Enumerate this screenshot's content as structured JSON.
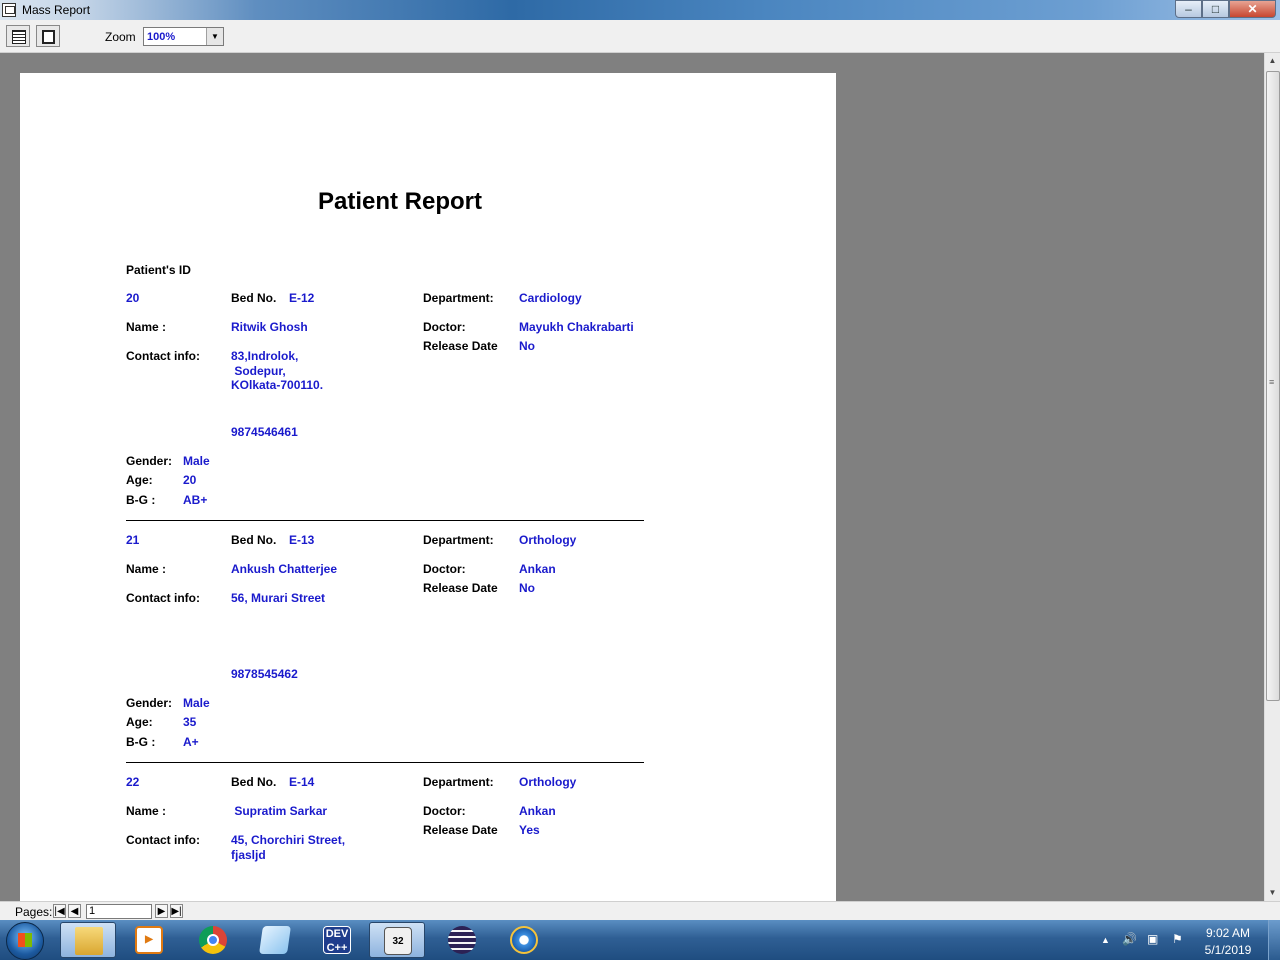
{
  "window": {
    "title": "Mass Report",
    "min": "–",
    "max": "□",
    "close": "✕"
  },
  "toolbar": {
    "zoom_label": "Zoom",
    "zoom_value": "100%"
  },
  "report": {
    "title": "Patient Report",
    "id_header": "Patient's ID",
    "labels": {
      "bed": "Bed No.",
      "department": "Department:",
      "name": "Name :",
      "doctor": "Doctor:",
      "release": "Release Date",
      "contact": "Contact info:",
      "gender": "Gender:",
      "age": "Age:",
      "bg": "B-G :"
    },
    "patients": [
      {
        "id": "20",
        "bed": "E-12",
        "department": "Cardiology",
        "name": "Ritwik Ghosh",
        "doctor": "Mayukh Chakrabarti",
        "release": "No",
        "address": "83,Indrolok,\n Sodepur,\nKOlkata-700110.",
        "phone": "9874546461",
        "gender": "Male",
        "age": "20",
        "bg": "AB+"
      },
      {
        "id": "21",
        "bed": "E-13",
        "department": "Orthology",
        "name": "Ankush Chatterjee",
        "doctor": "Ankan",
        "release": "No",
        "address": "56, Murari Street",
        "phone": "9878545462",
        "gender": "Male",
        "age": "35",
        "bg": "A+"
      },
      {
        "id": "22",
        "bed": "E-14",
        "department": "Orthology",
        "name": " Supratim Sarkar",
        "doctor": "Ankan",
        "release": "Yes",
        "address": "45, Chorchiri Street,\nfjasljd"
      }
    ]
  },
  "pagination": {
    "label": "Pages:",
    "current": "1"
  },
  "taskbar": {
    "app_badge": "32",
    "dev_label": "DEV\nC++",
    "time": "9:02 AM",
    "date": "5/1/2019"
  }
}
